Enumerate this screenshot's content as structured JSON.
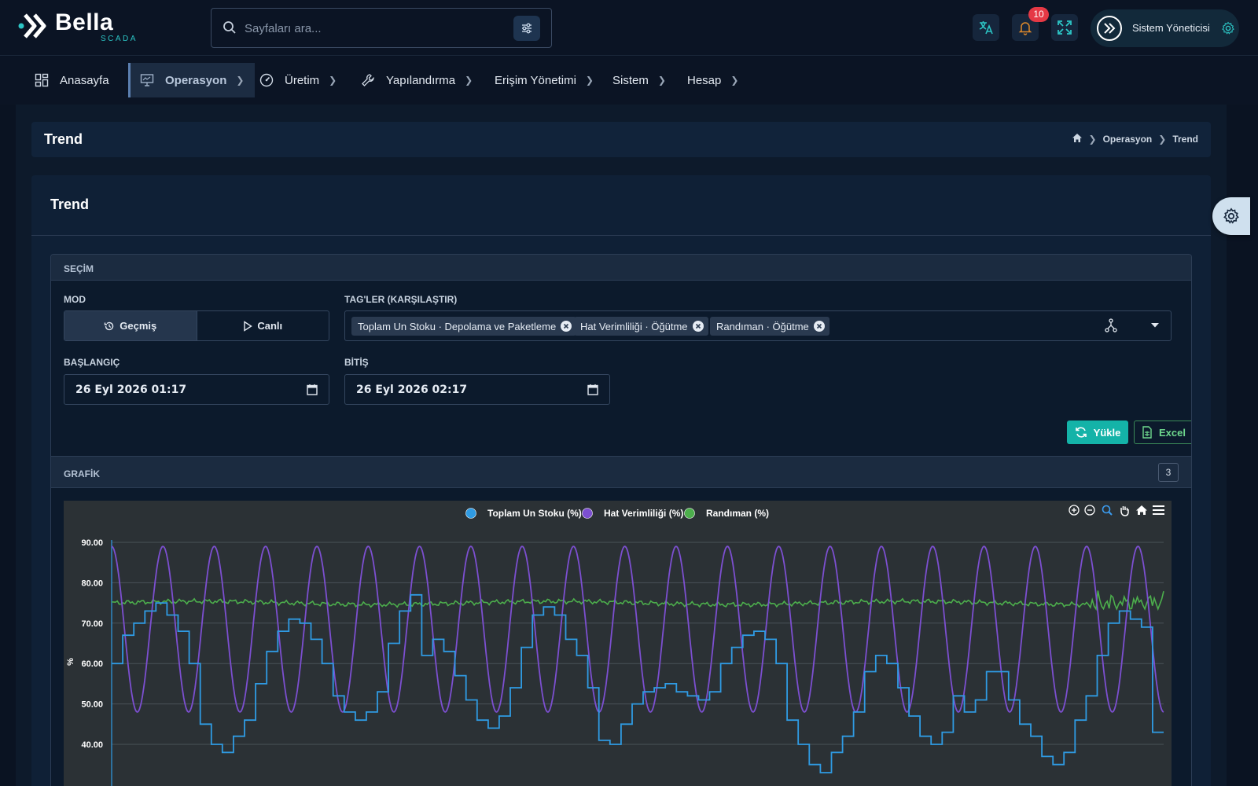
{
  "brand": {
    "name": "Bella",
    "sub": "SCADA"
  },
  "search": {
    "placeholder": "Sayfaları ara..."
  },
  "topbar": {
    "notifications_count": "10",
    "user_name": "Sistem Yöneticisi",
    "icons": [
      "translate-icon",
      "bell-icon",
      "fullscreen-icon",
      "gear-icon"
    ]
  },
  "nav": {
    "items": [
      {
        "label": "Anasayfa",
        "icon": "dashboard-icon"
      },
      {
        "label": "Operasyon",
        "icon": "monitor-icon",
        "active": true
      },
      {
        "label": "Üretim",
        "icon": "gauge-icon"
      },
      {
        "label": "Yapılandırma",
        "icon": "wrench-icon"
      },
      {
        "label": "Erişim Yönetimi"
      },
      {
        "label": "Sistem"
      },
      {
        "label": "Hesap"
      }
    ]
  },
  "page": {
    "title": "Trend",
    "breadcrumb": [
      "Operasyon",
      "Trend"
    ],
    "card_title": "Trend"
  },
  "selection": {
    "title": "SEÇİM",
    "mode_label": "MOD",
    "mode_options": [
      "Geçmiş",
      "Canlı"
    ],
    "mode_selected": "Geçmiş",
    "tags_label": "TAG'LER (KARŞILAŞTIR)",
    "tags": [
      "Toplam Un Stoku · Depolama ve Paketleme",
      "Hat Verimliliği · Öğütme",
      "Randıman · Öğütme"
    ],
    "start_label": "BAŞLANGIÇ",
    "start_value": "26 Eyl 2026 01:17",
    "end_label": "BİTİŞ",
    "end_value": "26 Eyl 2026 02:17",
    "load_button": "Yükle",
    "excel_button": "Excel"
  },
  "graph": {
    "title": "GRAFİK",
    "count": "3"
  },
  "chart_data": {
    "type": "line",
    "ylabel": "%",
    "ylim": [
      30,
      90
    ],
    "yticks": [
      "90.00",
      "80.00",
      "70.00",
      "60.00",
      "50.00",
      "40.00"
    ],
    "legend_position": "top-center",
    "grid": true,
    "series": [
      {
        "name": "Toplam Un Stoku (%)",
        "color": "#2f9be3",
        "values": [
          60,
          67,
          70,
          73,
          75,
          72,
          68,
          60,
          45,
          40,
          38,
          42,
          46,
          55,
          63,
          68,
          71,
          70,
          66,
          60,
          52,
          48,
          46,
          48,
          53,
          65,
          73,
          77,
          62,
          66,
          63,
          57,
          51,
          46,
          44,
          47,
          54,
          64,
          72,
          74,
          72,
          66,
          62,
          54,
          41,
          40,
          45,
          50,
          53,
          54,
          55,
          53,
          52,
          51,
          53,
          60,
          64,
          67,
          68,
          66,
          60,
          46,
          40,
          35,
          33,
          38,
          42,
          48,
          58,
          62,
          60,
          54,
          47,
          42,
          40,
          43,
          52,
          48,
          51,
          58,
          58,
          51,
          45,
          42,
          37,
          35,
          38,
          46,
          52,
          62,
          70,
          73,
          71,
          69,
          43
        ]
      },
      {
        "name": "Hat Verimliliği (%)",
        "color": "#7c4fd0",
        "amplitude": [
          48,
          89
        ],
        "cycles": 20.5
      },
      {
        "name": "Randıman (%)",
        "color": "#4cae4c",
        "mean": 75,
        "range": [
          73.5,
          79
        ]
      }
    ]
  }
}
